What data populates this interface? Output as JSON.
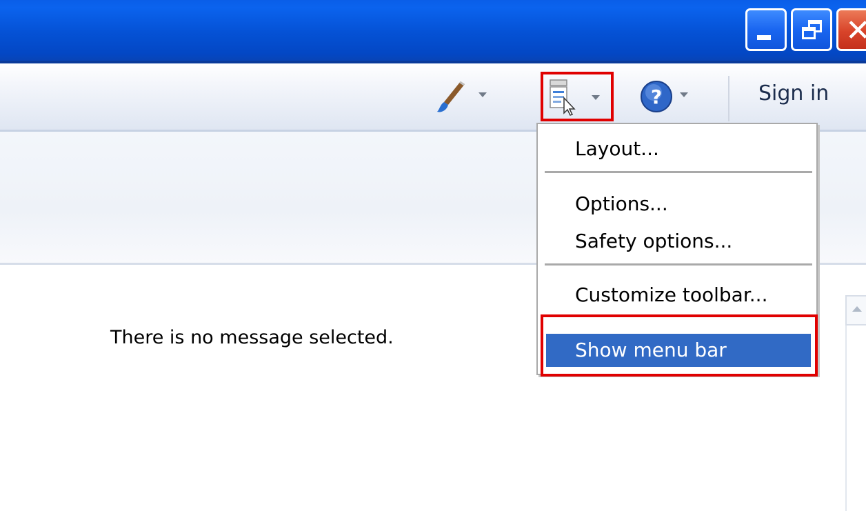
{
  "window": {
    "controls": [
      "minimize",
      "restore",
      "close"
    ],
    "title_bar_color": "#0552d6"
  },
  "toolbar": {
    "buttons": [
      {
        "icon": "paintbrush-icon",
        "has_dropdown": true
      },
      {
        "icon": "view-menu-icon",
        "has_dropdown": true,
        "highlighted": true
      },
      {
        "icon": "help-icon",
        "has_dropdown": true
      }
    ],
    "sign_in_label": "Sign in"
  },
  "menu": {
    "items": [
      {
        "label": "Layout..."
      },
      {
        "label": "Options..."
      },
      {
        "label": "Safety options..."
      },
      {
        "label": "Customize toolbar..."
      },
      {
        "label": "Show menu bar",
        "selected": true
      }
    ],
    "selected_color": "#316ac5",
    "annotation_color": "#e00000"
  },
  "reading_pane": {
    "empty_message": "There is no message selected."
  }
}
